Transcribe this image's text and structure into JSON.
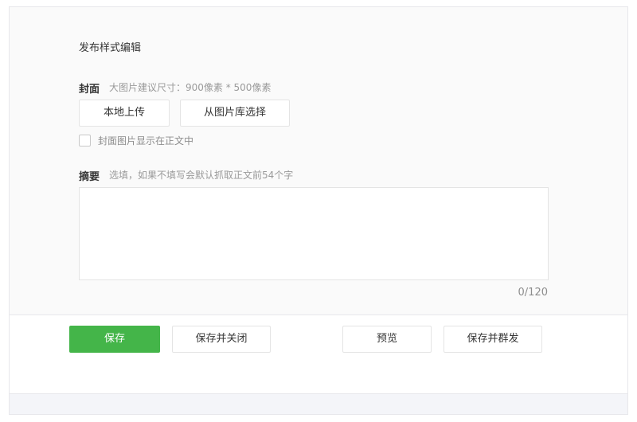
{
  "editor": {
    "title": "发布样式编辑",
    "cover": {
      "label": "封面",
      "hint": "大图片建议尺寸：900像素 * 500像素",
      "upload_label": "本地上传",
      "library_label": "从图片库选择",
      "show_in_body_label": "封面图片显示在正文中",
      "show_in_body_checked": false
    },
    "summary": {
      "label": "摘要",
      "hint": "选填，如果不填写会默认抓取正文前54个字",
      "value": "",
      "counter": "0/120"
    }
  },
  "actions": {
    "save": "保存",
    "save_close": "保存并关闭",
    "preview": "预览",
    "save_broadcast": "保存并群发",
    "accent_color": "#44b549"
  }
}
